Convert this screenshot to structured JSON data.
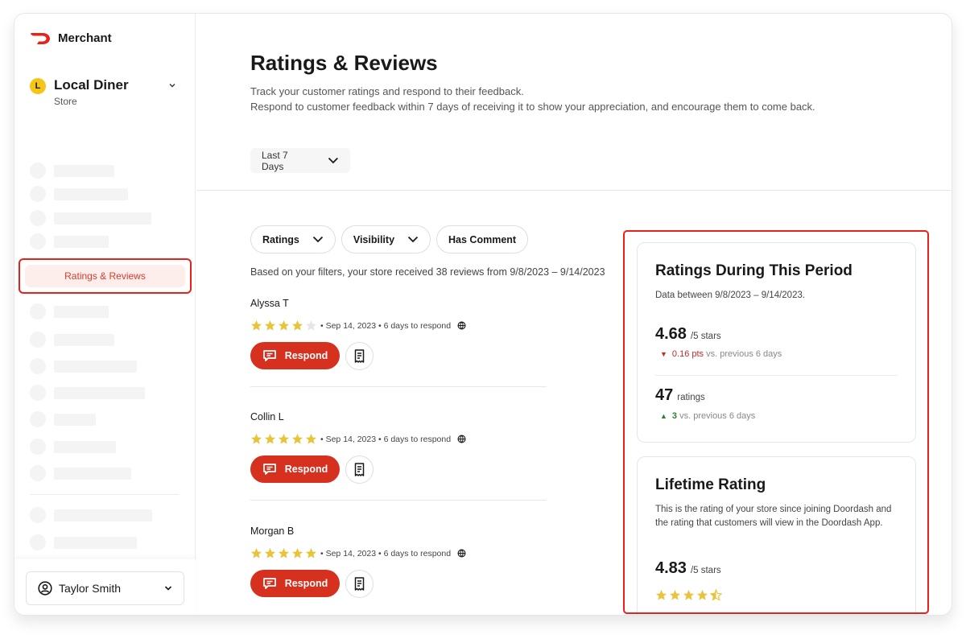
{
  "app": {
    "brand": "Merchant",
    "brand_color": "#e8211a"
  },
  "store": {
    "initial": "L",
    "name": "Local Diner",
    "type": "Store"
  },
  "sidebar": {
    "active_item": "Ratings & Reviews",
    "user_name": "Taylor Smith"
  },
  "page": {
    "title": "Ratings & Reviews",
    "description_1": "Track your customer ratings and respond to their feedback.",
    "description_2": "Respond to customer feedback within 7 days of receiving it to show your appreciation, and encourage them to come back.",
    "date_range": "Last 7 Days"
  },
  "filters": {
    "ratings": "Ratings",
    "visibility": "Visibility",
    "has_comment": "Has Comment"
  },
  "summary": "Based on your filters, your store received 38 reviews from 9/8/2023 – 9/14/2023",
  "reviews": [
    {
      "name": "Alyssa T",
      "rating": 4,
      "meta": "• Sep 14, 2023 • 6 days to respond",
      "respond_label": "Respond"
    },
    {
      "name": "Collin L",
      "rating": 5,
      "meta": "• Sep 14, 2023 • 6 days to respond",
      "respond_label": "Respond"
    },
    {
      "name": "Morgan B",
      "rating": 5,
      "meta": "• Sep 14, 2023 • 6 days to respond",
      "respond_label": "Respond"
    }
  ],
  "period_card": {
    "title": "Ratings During This Period",
    "subtitle": "Data between 9/8/2023 – 9/14/2023.",
    "avg_rating": "4.68",
    "avg_unit": "/5 stars",
    "avg_delta": "0.16 pts",
    "avg_delta_direction": "down",
    "avg_delta_suffix": "vs. previous 6 days",
    "count": "47",
    "count_unit": "ratings",
    "count_delta": "3",
    "count_delta_direction": "up",
    "count_delta_suffix": "vs. previous 6 days"
  },
  "lifetime_card": {
    "title": "Lifetime Rating",
    "description": "This is the rating of your store since joining Doordash and the rating that customers will view in the Doordash App.",
    "rating": "4.83",
    "unit": "/5 stars",
    "stars": 4.5
  },
  "colors": {
    "accent": "#d6301f",
    "star": "#e8c43a",
    "star_empty": "#e6e6e6",
    "negative": "#c62828",
    "positive": "#2e7d32"
  }
}
